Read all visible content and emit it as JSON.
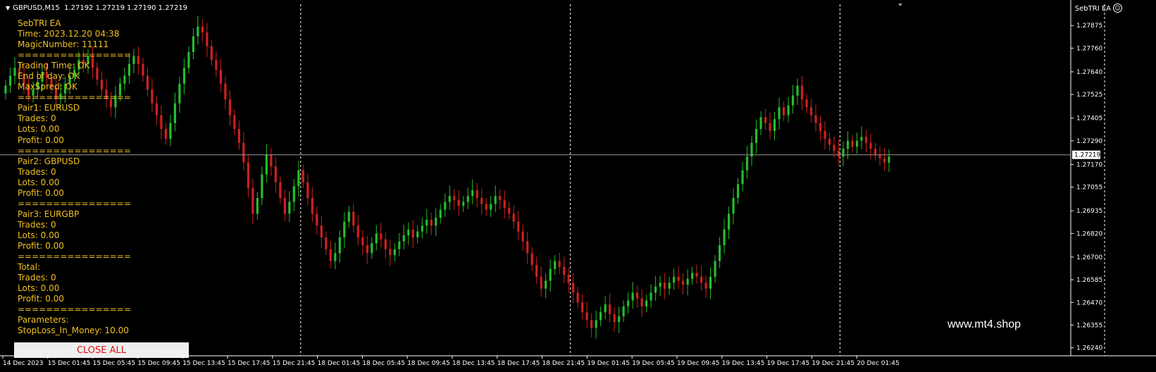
{
  "header": {
    "symbol_timeframe": "GBPUSD,M15",
    "ohlc": "1.27192 1.27219 1.27190 1.27219",
    "ea_name": "SebTRI EA",
    "smiley": "☺"
  },
  "info_panel": {
    "lines": [
      "SebTRI EA",
      "Time: 2023.12.20 04:38",
      "MagicNumber: 11111",
      "================",
      "Trading Time: OK",
      "End of day: OK",
      "MaxSpred: OK",
      "================",
      "Pair1: EURUSD",
      "Trades: 0",
      "Lots: 0.00",
      "Profit: 0.00",
      "================",
      "Pair2: GBPUSD",
      "Trades: 0",
      "Lots: 0.00",
      "Profit: 0.00",
      "================",
      "Pair3: EURGBP",
      "Trades: 0",
      "Lots: 0.00",
      "Profit: 0.00",
      "================",
      "Total:",
      "Trades: 0",
      "Lots: 0.00",
      "Profit: 0.00",
      "================",
      "Parameters:",
      "StopLoss_In_Money: 10.00"
    ]
  },
  "close_button": {
    "label": "CLOSE ALL"
  },
  "watermark": "www.mt4.shop",
  "colors": {
    "background": "#000000",
    "bull": "#22c02a",
    "bear": "#d02020",
    "panel_text": "#f0c020",
    "grid": "#ffffff"
  },
  "chart_data": {
    "type": "candlestick",
    "symbol": "GBPUSD",
    "timeframe": "M15",
    "price_ticks": [
      "1.27875",
      "1.27760",
      "1.27640",
      "1.27525",
      "1.27405",
      "1.27290",
      "1.27170",
      "1.27055",
      "1.26935",
      "1.26820",
      "1.26700",
      "1.26585",
      "1.26470",
      "1.26355",
      "1.26240"
    ],
    "ylim": [
      1.2621,
      1.2794
    ],
    "current_price": "1.27219",
    "time_labels": [
      "14 Dec 2023",
      "15 Dec 01:45",
      "15 Dec 05:45",
      "15 Dec 09:45",
      "15 Dec 13:45",
      "15 Dec 17:45",
      "15 Dec 21:45",
      "18 Dec 01:45",
      "18 Dec 05:45",
      "18 Dec 09:45",
      "18 Dec 13:45",
      "18 Dec 17:45",
      "18 Dec 21:45",
      "19 Dec 01:45",
      "19 Dec 05:45",
      "19 Dec 09:45",
      "19 Dec 13:45",
      "19 Dec 17:45",
      "19 Dec 21:45",
      "20 Dec 01:45"
    ],
    "day_separators": [
      "15 Dec 21:45",
      "18 Dec 21:45",
      "19 Dec 21:45"
    ],
    "closes": [
      1.2757,
      1.2762,
      1.2766,
      1.2763,
      1.2758,
      1.2752,
      1.2755,
      1.2759,
      1.2764,
      1.2761,
      1.2756,
      1.275,
      1.2753,
      1.2758,
      1.2762,
      1.2765,
      1.277,
      1.2768,
      1.2772,
      1.2766,
      1.276,
      1.2755,
      1.275,
      1.2746,
      1.2752,
      1.2758,
      1.2762,
      1.2768,
      1.2772,
      1.2768,
      1.2762,
      1.2755,
      1.2748,
      1.2742,
      1.2735,
      1.273,
      1.2738,
      1.2748,
      1.2758,
      1.2766,
      1.2774,
      1.2782,
      1.2787,
      1.2784,
      1.2777,
      1.277,
      1.2765,
      1.2758,
      1.275,
      1.2742,
      1.2735,
      1.2728,
      1.2718,
      1.2705,
      1.2692,
      1.27,
      1.2712,
      1.2722,
      1.2716,
      1.2708,
      1.27,
      1.2692,
      1.2698,
      1.2706,
      1.2714,
      1.2708,
      1.27,
      1.2692,
      1.2686,
      1.268,
      1.2674,
      1.2668,
      1.2672,
      1.268,
      1.2688,
      1.2693,
      1.2686,
      1.268,
      1.2676,
      1.2672,
      1.2677,
      1.2682,
      1.2679,
      1.2674,
      1.2671,
      1.2674,
      1.2678,
      1.2681,
      1.2684,
      1.268,
      1.2683,
      1.2686,
      1.2689,
      1.2686,
      1.269,
      1.2694,
      1.2698,
      1.2701,
      1.2699,
      1.2696,
      1.2698,
      1.2701,
      1.2704,
      1.27,
      1.2697,
      1.2694,
      1.2697,
      1.2701,
      1.2699,
      1.2695,
      1.2692,
      1.2688,
      1.2683,
      1.2678,
      1.2672,
      1.2666,
      1.266,
      1.2654,
      1.2658,
      1.2664,
      1.2668,
      1.2665,
      1.2661,
      1.2657,
      1.2652,
      1.2647,
      1.2642,
      1.2638,
      1.2634,
      1.2638,
      1.2642,
      1.2646,
      1.2641,
      1.2637,
      1.264,
      1.2645,
      1.2648,
      1.2652,
      1.2649,
      1.2645,
      1.2648,
      1.2652,
      1.2655,
      1.2657,
      1.2654,
      1.2657,
      1.266,
      1.2658,
      1.2656,
      1.2659,
      1.2662,
      1.266,
      1.2657,
      1.2654,
      1.266,
      1.2668,
      1.2676,
      1.2684,
      1.2692,
      1.27,
      1.2707,
      1.2714,
      1.2721,
      1.2728,
      1.2735,
      1.2741,
      1.2738,
      1.2734,
      1.274,
      1.2746,
      1.2742,
      1.2747,
      1.2752,
      1.2757,
      1.275,
      1.2746,
      1.2742,
      1.2738,
      1.2734,
      1.273,
      1.2727,
      1.2724,
      1.2721,
      1.2725,
      1.2729,
      1.2726,
      1.2729,
      1.2731,
      1.2728,
      1.2725,
      1.2722,
      1.272,
      1.2718,
      1.2721
    ]
  }
}
